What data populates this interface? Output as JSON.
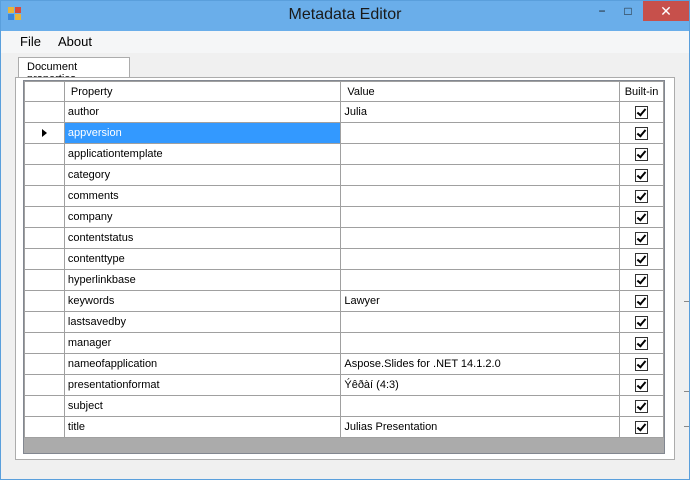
{
  "window": {
    "title": "Metadata Editor",
    "minimize_glyph": "−",
    "maximize_glyph": "□",
    "close_glyph": "✕"
  },
  "menu": {
    "items": [
      "File",
      "About"
    ]
  },
  "tabs": [
    {
      "label": "Document properties",
      "active": true
    }
  ],
  "grid": {
    "columns": {
      "property": "Property",
      "value": "Value",
      "builtin": "Built-in"
    },
    "selected_row_index": 1,
    "rows": [
      {
        "property": "author",
        "value": "Julia",
        "builtin": true
      },
      {
        "property": "appversion",
        "value": "",
        "builtin": true
      },
      {
        "property": "applicationtemplate",
        "value": "",
        "builtin": true
      },
      {
        "property": "category",
        "value": "",
        "builtin": true
      },
      {
        "property": "comments",
        "value": "",
        "builtin": true
      },
      {
        "property": "company",
        "value": "",
        "builtin": true
      },
      {
        "property": "contentstatus",
        "value": "",
        "builtin": true
      },
      {
        "property": "contenttype",
        "value": "",
        "builtin": true
      },
      {
        "property": "hyperlinkbase",
        "value": "",
        "builtin": true
      },
      {
        "property": "keywords",
        "value": "Lawyer",
        "builtin": true
      },
      {
        "property": "lastsavedby",
        "value": "",
        "builtin": true
      },
      {
        "property": "manager",
        "value": "",
        "builtin": true
      },
      {
        "property": "nameofapplication",
        "value": "Aspose.Slides for .NET 14.1.2.0",
        "builtin": true
      },
      {
        "property": "presentationformat",
        "value": "Ýêðàí (4:3)",
        "builtin": true
      },
      {
        "property": "subject",
        "value": "",
        "builtin": true
      },
      {
        "property": "title",
        "value": "Julias Presentation",
        "builtin": true
      }
    ]
  },
  "colors": {
    "titlebar": "#6aaeea",
    "close_button": "#c7504b",
    "selection": "#3399ff"
  }
}
